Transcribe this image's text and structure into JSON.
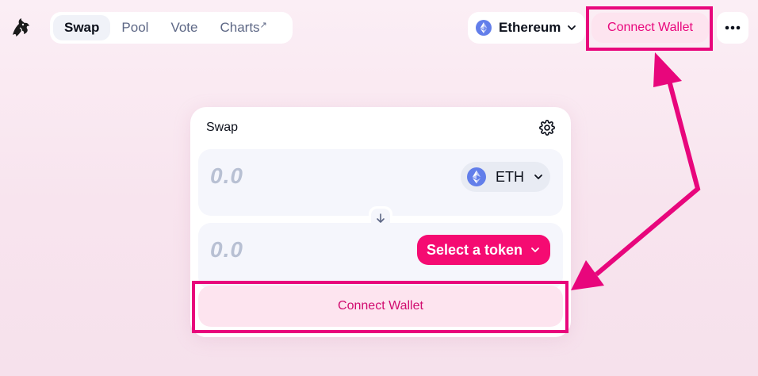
{
  "nav": {
    "items": [
      {
        "label": "Swap",
        "active": true
      },
      {
        "label": "Pool"
      },
      {
        "label": "Vote"
      },
      {
        "label": "Charts",
        "external_icon": "↗"
      }
    ]
  },
  "network": {
    "label": "Ethereum",
    "icon": "ethereum-icon"
  },
  "header": {
    "connect_label": "Connect Wallet",
    "more_icon": "more-dots-icon"
  },
  "swap": {
    "title": "Swap",
    "settings_icon": "gear-icon",
    "input": {
      "amount": "0.0",
      "token": "ETH"
    },
    "output": {
      "amount": "0.0",
      "select_label": "Select a token"
    },
    "connect_label": "Connect Wallet"
  },
  "colors": {
    "accent": "#e8067c",
    "button_pink": "#f50b72",
    "connect_bg": "#fde4ef"
  }
}
